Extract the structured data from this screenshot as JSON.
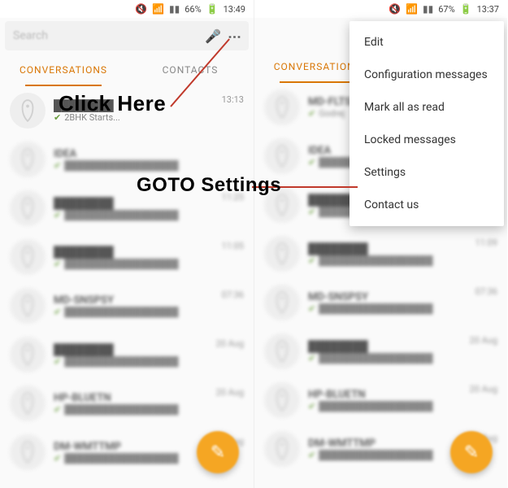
{
  "left": {
    "status": {
      "battery": "66%",
      "time": "13:49"
    },
    "search_placeholder": "Search",
    "tabs": {
      "conversations": "CONVERSATIONS",
      "contacts": "CONTACTS"
    },
    "rows": [
      {
        "preview": "2BHK Starts...",
        "time": "13:13"
      },
      {
        "name": "IDEA",
        "preview": "",
        "time": ""
      },
      {
        "name": "",
        "preview": "",
        "time": "11:25"
      },
      {
        "name": "",
        "preview": "",
        "time": "11:05"
      },
      {
        "name": "MD-SNSPSY",
        "preview": "",
        "time": "07:36"
      },
      {
        "name": "",
        "preview": "",
        "time": "20 Aug"
      },
      {
        "name": "HP-BLUETN",
        "preview": "",
        "time": "20 Aug"
      },
      {
        "name": "DM-WMTTMP",
        "preview": "",
        "time": "20 Aug"
      }
    ]
  },
  "right": {
    "status": {
      "battery": "67%",
      "time": "13:37"
    },
    "tabs": {
      "conversations": "CONVERSATIONS"
    },
    "menu": [
      "Edit",
      "Configuration messages",
      "Mark all as read",
      "Locked messages",
      "Settings",
      "Contact us"
    ],
    "rows": [
      {
        "name": "MD-FLTS",
        "preview": "Godrej",
        "time": ""
      },
      {
        "name": "IDEA",
        "preview": "",
        "time": ""
      },
      {
        "name": "",
        "preview": "",
        "time": ""
      },
      {
        "name": "",
        "preview": "",
        "time": "11:09"
      },
      {
        "name": "MD-SNSPSY",
        "preview": "",
        "time": "07:36"
      },
      {
        "name": "",
        "preview": "",
        "time": "20 Aug"
      },
      {
        "name": "HP-BLUETN",
        "preview": "",
        "time": "20 Aug"
      },
      {
        "name": "DM-WMTTMP",
        "preview": "",
        "time": "20 Aug"
      }
    ]
  },
  "annotations": {
    "click_here": "Click Here",
    "goto_settings": "GOTO Settings"
  }
}
